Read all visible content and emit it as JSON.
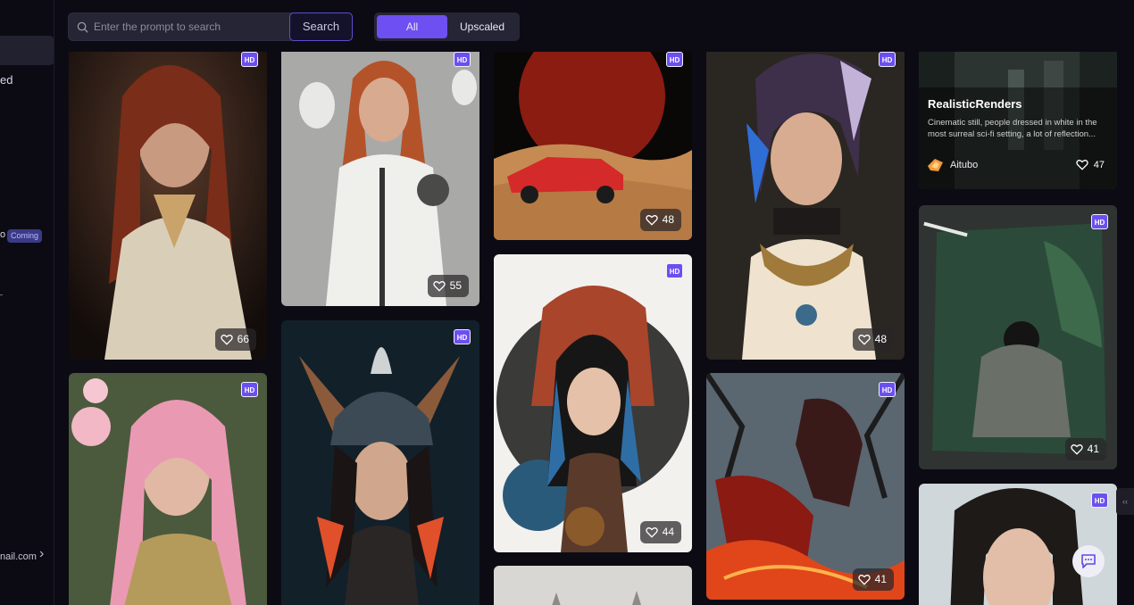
{
  "sidebar": {
    "partial_label": "ed",
    "partial_o": "o",
    "coming_badge": "Coming",
    "email_partial": "nail.com"
  },
  "search": {
    "placeholder": "Enter the prompt to search",
    "button_label": "Search"
  },
  "filter": {
    "all_label": "All",
    "upscaled_label": "Upscaled"
  },
  "featured": {
    "name": "RealisticRenders",
    "description": "Cinematic still, people dressed in white in the most surreal sci-fi setting, a lot of reflection...",
    "user": "Aitubo",
    "likes": "47"
  },
  "cards": [
    {
      "badge": "HD",
      "likes": "66"
    },
    {
      "badge": "HD",
      "likes": "55"
    },
    {
      "badge": "HD",
      "likes": "48"
    },
    {
      "badge": "HD",
      "likes": "48"
    },
    {
      "badge": "HD",
      "likes": ""
    },
    {
      "badge": "HD",
      "likes": ""
    },
    {
      "badge": "HD",
      "likes": "44"
    },
    {
      "badge": "HD",
      "likes": "41"
    },
    {
      "badge": "HD",
      "likes": "41"
    },
    {
      "badge": "HD",
      "likes": ""
    }
  ],
  "colors": {
    "accent": "#6e4ff2",
    "background": "#0c0b14",
    "panel": "#262535"
  }
}
